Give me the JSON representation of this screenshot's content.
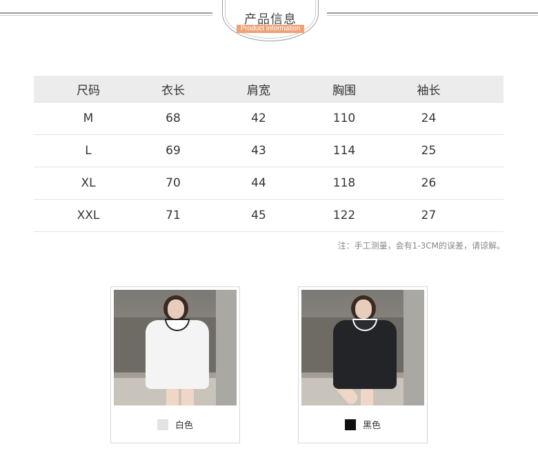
{
  "header": {
    "title": "产品信息",
    "subtitle": "Product information"
  },
  "size_table": {
    "columns": [
      "尺码",
      "衣长",
      "肩宽",
      "胸围",
      "袖长"
    ],
    "rows": [
      [
        "M",
        "68",
        "42",
        "110",
        "24"
      ],
      [
        "L",
        "69",
        "43",
        "114",
        "25"
      ],
      [
        "XL",
        "70",
        "44",
        "118",
        "26"
      ],
      [
        "XXL",
        "71",
        "45",
        "122",
        "27"
      ]
    ],
    "note": "注：手工测量，会有1-3CM的误差，请谅解。"
  },
  "colors": [
    {
      "label": "白色",
      "swatch": "#e3e3e3"
    },
    {
      "label": "黑色",
      "swatch": "#111111"
    }
  ]
}
